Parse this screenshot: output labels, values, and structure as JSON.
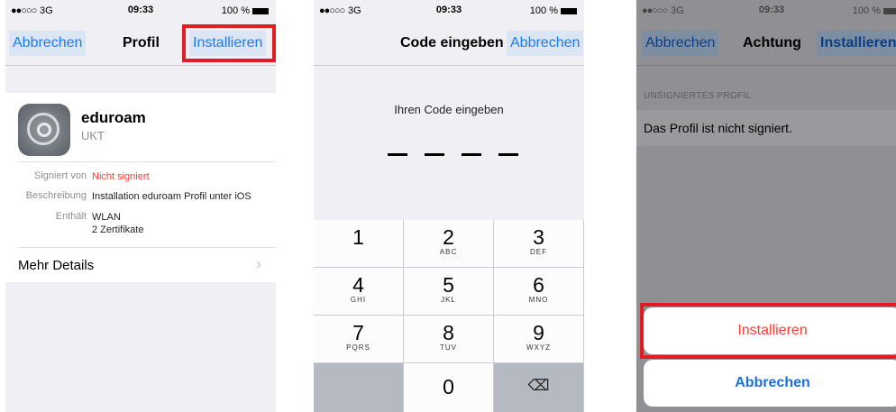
{
  "status": {
    "signal": "●●○○○",
    "network": "3G",
    "time": "09:33",
    "battery": "100 %"
  },
  "screen1": {
    "cancel": "Abbrechen",
    "title": "Profil",
    "install": "Installieren",
    "profile_name": "eduroam",
    "profile_org": "UKT",
    "signed_label": "Signiert von",
    "signed_value": "Nicht signiert",
    "desc_label": "Beschreibung",
    "desc_value": "Installation eduroam Profil unter iOS",
    "contains_label": "Enthält",
    "contains_value1": "WLAN",
    "contains_value2": "2 Zertifikate",
    "more_details": "Mehr Details",
    "chevron": "›"
  },
  "screen2": {
    "title": "Code eingeben",
    "cancel": "Abbrechen",
    "prompt": "Ihren Code eingeben",
    "keys": [
      {
        "num": "1",
        "letters": ""
      },
      {
        "num": "2",
        "letters": "ABC"
      },
      {
        "num": "3",
        "letters": "DEF"
      },
      {
        "num": "4",
        "letters": "GHI"
      },
      {
        "num": "5",
        "letters": "JKL"
      },
      {
        "num": "6",
        "letters": "MNO"
      },
      {
        "num": "7",
        "letters": "PQRS"
      },
      {
        "num": "8",
        "letters": "TUV"
      },
      {
        "num": "9",
        "letters": "WXYZ"
      },
      {
        "num": "0",
        "letters": ""
      }
    ],
    "delete_symbol": "⌫"
  },
  "screen3": {
    "cancel": "Abbrechen",
    "title": "Achtung",
    "install": "Installieren",
    "section": "UNSIGNIERTES PROFIL",
    "message": "Das Profil ist nicht signiert.",
    "sheet_install": "Installieren",
    "sheet_cancel": "Abbrechen"
  },
  "colors": {
    "ios_blue": "#1b7cf5",
    "highlight_red": "#e31b23",
    "warning_red": "#ff3b30"
  }
}
